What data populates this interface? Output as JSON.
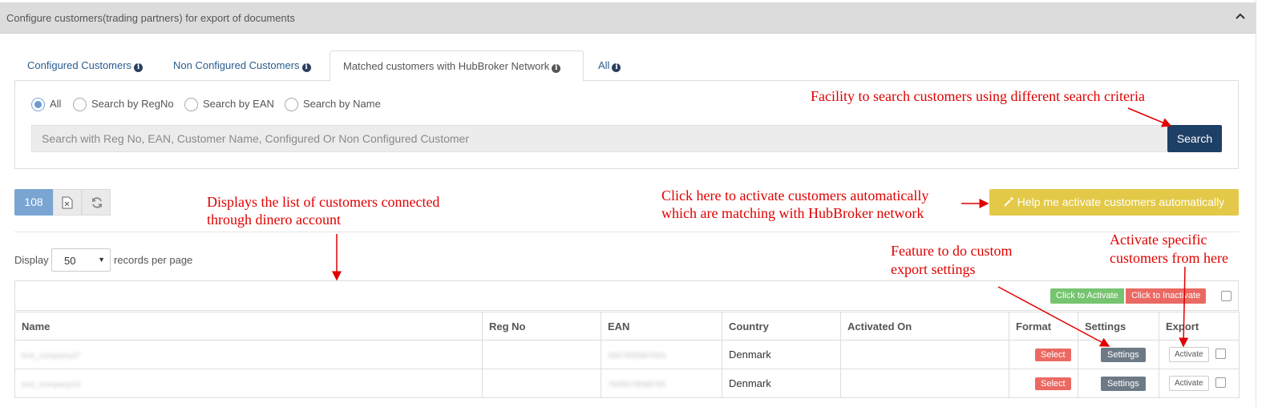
{
  "panel": {
    "title": "Configure customers(trading partners) for export of documents"
  },
  "tabs": [
    {
      "label": "Configured Customers"
    },
    {
      "label": "Non Configured Customers"
    },
    {
      "label": "Matched customers with HubBroker Network"
    },
    {
      "label": "All"
    }
  ],
  "search": {
    "radios": [
      "All",
      "Search by RegNo",
      "Search by EAN",
      "Search by Name"
    ],
    "selected": "All",
    "placeholder": "Search with Reg No, EAN, Customer Name, Configured Or Non Configured Customer",
    "button": "Search"
  },
  "toolbar": {
    "count": "108",
    "help_button": "Help me activate customers automatically"
  },
  "paging": {
    "display_label": "Display",
    "page_size": "50",
    "records_label": "records per page"
  },
  "bulk": {
    "activate": "Click to Activate",
    "inactivate": "Click to Inactivate"
  },
  "table": {
    "headers": [
      "Name",
      "Reg No",
      "EAN",
      "Country",
      "Activated On",
      "Format",
      "Settings",
      "Export"
    ],
    "rows": [
      {
        "name": "test_company47",
        "reg_no": "",
        "ean": "4567890987654",
        "country": "Denmark",
        "activated_on": "",
        "format_btn": "Select",
        "settings_btn": "Settings",
        "export_btn": "Activate"
      },
      {
        "name": "test_company16",
        "reg_no": "",
        "ean": "7845678098765",
        "country": "Denmark",
        "activated_on": "",
        "format_btn": "Select",
        "settings_btn": "Settings",
        "export_btn": "Activate"
      }
    ]
  },
  "annotations": {
    "search": "Facility to search customers using different search criteria",
    "list_1": "Displays the list of customers connected",
    "list_2": "through dinero account",
    "auto_1": "Click here to activate customers automatically",
    "auto_2": "which are matching with HubBroker network",
    "settings_1": "Feature to do custom",
    "settings_2": "export settings",
    "activate_1": "Activate specific",
    "activate_2": "customers from here"
  },
  "colors": {
    "primary": "#1e3f66",
    "help_yellow": "#e3c947",
    "annotation_red": "#e00000",
    "activate_green": "#76c46f",
    "inactivate_red": "#ea6a63"
  }
}
